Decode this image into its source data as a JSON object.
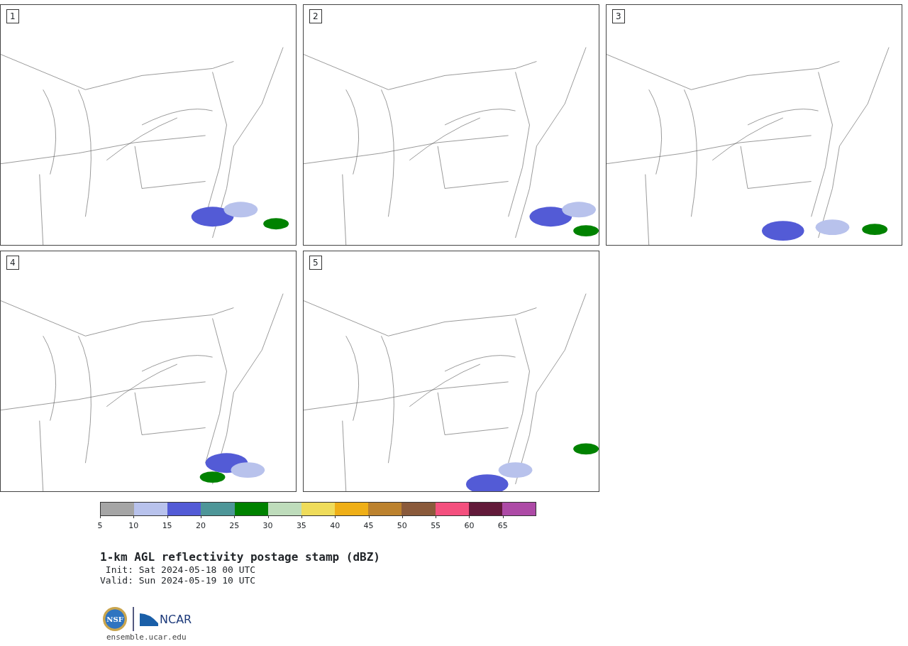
{
  "panels": [
    {
      "label": "1"
    },
    {
      "label": "2"
    },
    {
      "label": "3"
    },
    {
      "label": "4"
    },
    {
      "label": "5"
    }
  ],
  "colorbar": {
    "segments": [
      {
        "color": "#a5a5a5"
      },
      {
        "color": "#b8c2ec"
      },
      {
        "color": "#535bd6"
      },
      {
        "color": "#4e9698"
      },
      {
        "color": "#008200"
      },
      {
        "color": "#bedcbb"
      },
      {
        "color": "#efdc5b"
      },
      {
        "color": "#efaf17"
      },
      {
        "color": "#bc822e"
      },
      {
        "color": "#8a5a3b"
      },
      {
        "color": "#f4507e"
      },
      {
        "color": "#621a3a"
      },
      {
        "color": "#ad4aa6"
      }
    ],
    "ticks": [
      "5",
      "10",
      "15",
      "20",
      "25",
      "30",
      "35",
      "40",
      "45",
      "50",
      "55",
      "60",
      "65"
    ]
  },
  "title": "1-km AGL reflectivity postage stamp (dBZ)",
  "init": " Init: Sat 2024-05-18 00 UTC",
  "valid": "Valid: Sun 2024-05-19 10 UTC",
  "logos": {
    "left": "NSF",
    "right": "NCAR"
  },
  "url": "ensemble.ucar.edu"
}
